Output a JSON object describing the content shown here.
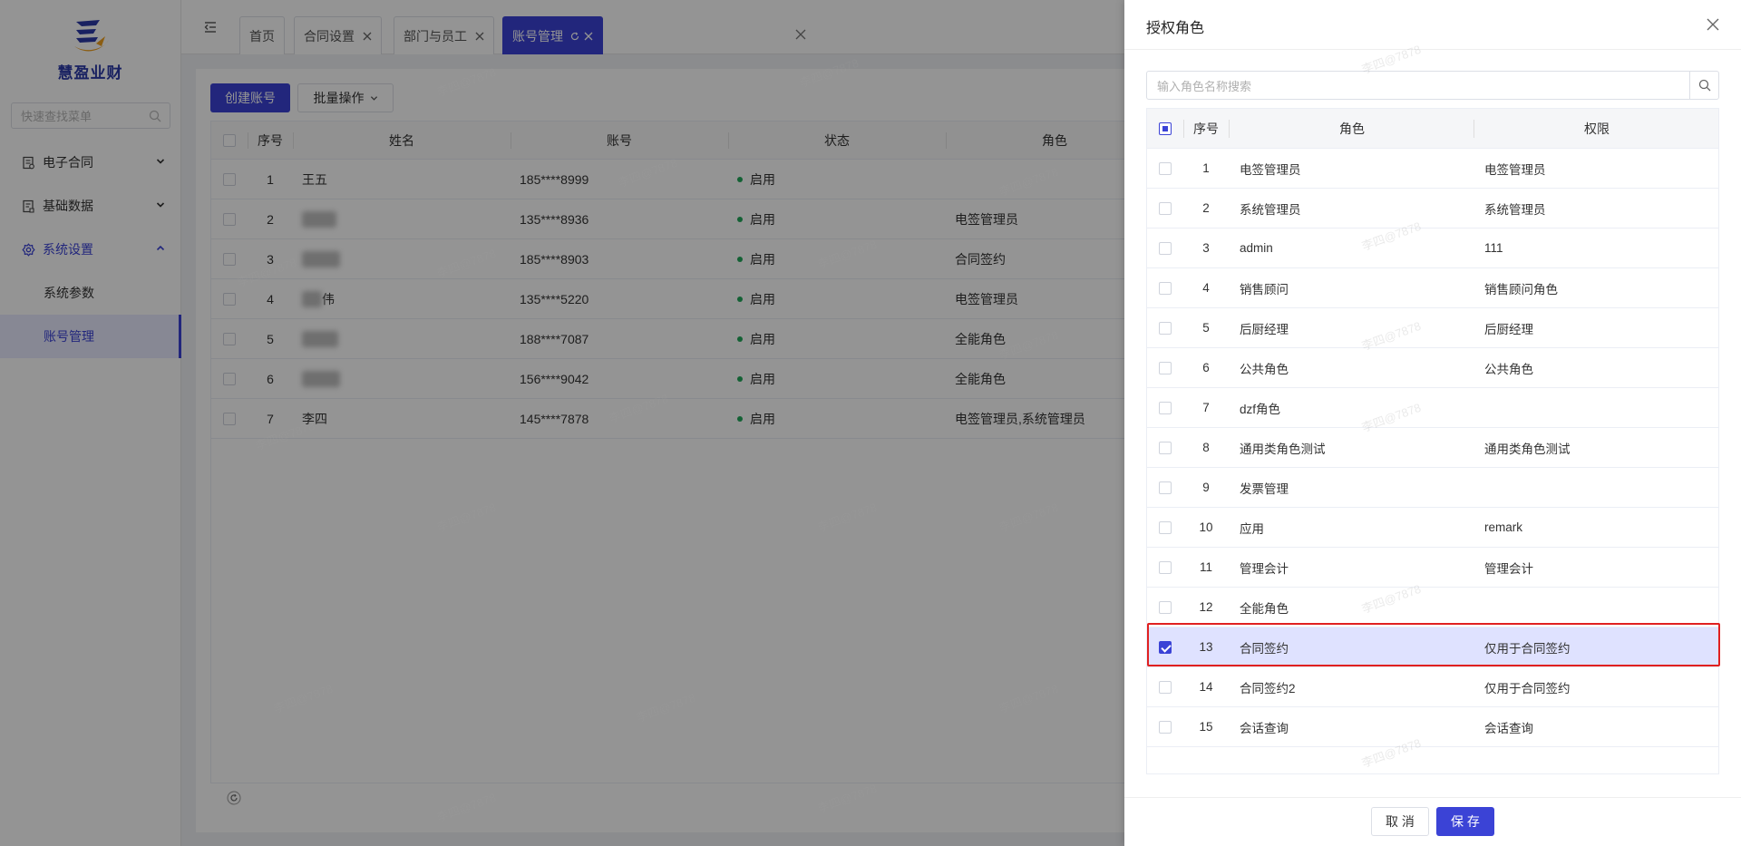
{
  "sidebar": {
    "brand": "慧盈业财",
    "search_placeholder": "快速查找菜单",
    "menu": [
      {
        "label": "电子合同",
        "icon": "document-icon"
      },
      {
        "label": "基础数据",
        "icon": "database-icon"
      },
      {
        "label": "系统设置",
        "icon": "gear-icon"
      }
    ],
    "submenu": [
      "系统参数",
      "账号管理"
    ]
  },
  "tabs": [
    {
      "label": "首页"
    },
    {
      "label": "合同设置"
    },
    {
      "label": "部门与员工"
    },
    {
      "label": "账号管理"
    }
  ],
  "toolbar": {
    "create_label": "创建账号",
    "batch_label": "批量操作"
  },
  "account_table": {
    "headers": [
      "序号",
      "姓名",
      "账号",
      "状态",
      "角色"
    ],
    "rows": [
      {
        "no": "1",
        "name": "王五",
        "account": "185****8999",
        "status": "启用",
        "role": ""
      },
      {
        "no": "2",
        "name": "",
        "account": "135****8936",
        "status": "启用",
        "role": "电签管理员"
      },
      {
        "no": "3",
        "name": "",
        "account": "185****8903",
        "status": "启用",
        "role": "合同签约"
      },
      {
        "no": "4",
        "name": "伟",
        "account": "135****5220",
        "status": "启用",
        "role": "电签管理员"
      },
      {
        "no": "5",
        "name": "",
        "account": "188****7087",
        "status": "启用",
        "role": "全能角色"
      },
      {
        "no": "6",
        "name": "",
        "account": "156****9042",
        "status": "启用",
        "role": "全能角色"
      },
      {
        "no": "7",
        "name": "李四",
        "account": "145****7878",
        "status": "启用",
        "role": "电签管理员,系统管理员"
      }
    ]
  },
  "drawer": {
    "title": "授权角色",
    "search_placeholder": "输入角色名称搜索",
    "headers": [
      "序号",
      "角色",
      "权限"
    ],
    "rows": [
      {
        "no": "1",
        "role": "电签管理员",
        "perm": "电签管理员",
        "checked": false
      },
      {
        "no": "2",
        "role": "系统管理员",
        "perm": "系统管理员",
        "checked": false
      },
      {
        "no": "3",
        "role": "admin",
        "perm": "111",
        "checked": false
      },
      {
        "no": "4",
        "role": "销售顾问",
        "perm": "销售顾问角色",
        "checked": false
      },
      {
        "no": "5",
        "role": "后厨经理",
        "perm": "后厨经理",
        "checked": false
      },
      {
        "no": "6",
        "role": "公共角色",
        "perm": "公共角色",
        "checked": false
      },
      {
        "no": "7",
        "role": "dzf角色",
        "perm": "",
        "checked": false
      },
      {
        "no": "8",
        "role": "通用类角色测试",
        "perm": "通用类角色测试",
        "checked": false
      },
      {
        "no": "9",
        "role": "发票管理",
        "perm": "",
        "checked": false
      },
      {
        "no": "10",
        "role": "应用",
        "perm": "remark",
        "checked": false
      },
      {
        "no": "11",
        "role": "管理会计",
        "perm": "管理会计",
        "checked": false
      },
      {
        "no": "12",
        "role": "全能角色",
        "perm": "",
        "checked": false
      },
      {
        "no": "13",
        "role": "合同签约",
        "perm": "仅用于合同签约",
        "checked": true
      },
      {
        "no": "14",
        "role": "合同签约2",
        "perm": "仅用于合同签约",
        "checked": false
      },
      {
        "no": "15",
        "role": "会话查询",
        "perm": "会话查询",
        "checked": false
      }
    ],
    "cancel_label": "取 消",
    "save_label": "保 存"
  },
  "watermark": "李四@7878",
  "colors": {
    "accent": "#3b43d6",
    "status_enabled": "#22a85a",
    "highlight": "#e02020"
  }
}
